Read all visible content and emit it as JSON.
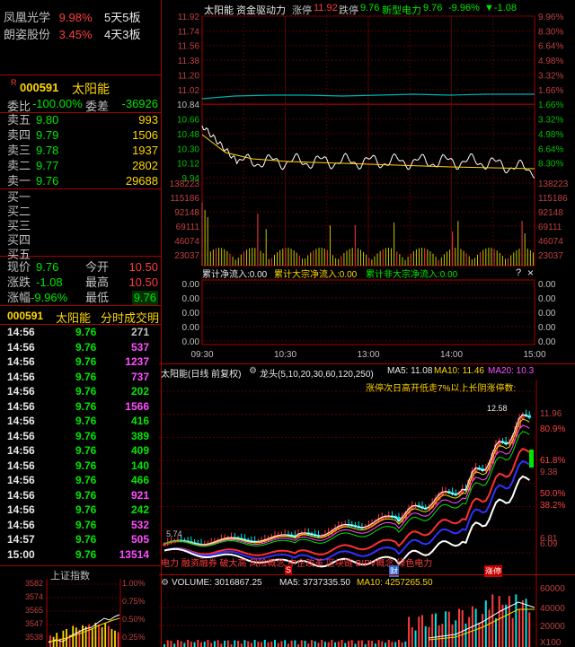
{
  "limit_up_board": [
    {
      "name": "凤凰光学",
      "pct": "9.98%",
      "streak": "5天5板"
    },
    {
      "name": "朗姿股份",
      "pct": "3.45%",
      "streak": "4天3板"
    }
  ],
  "stock": {
    "marker": "R",
    "code": "000591",
    "name": "太阳能"
  },
  "committee": {
    "ratio_label": "委比",
    "ratio": "-100.00%",
    "diff_label": "委差",
    "diff": "-36926"
  },
  "asks": [
    {
      "label": "卖五",
      "price": "9.80",
      "vol": "993"
    },
    {
      "label": "卖四",
      "price": "9.79",
      "vol": "1506"
    },
    {
      "label": "卖三",
      "price": "9.78",
      "vol": "1937"
    },
    {
      "label": "卖二",
      "price": "9.77",
      "vol": "2802"
    },
    {
      "label": "卖一",
      "price": "9.76",
      "vol": "29688"
    }
  ],
  "bids": [
    {
      "label": "买一"
    },
    {
      "label": "买二"
    },
    {
      "label": "买三"
    },
    {
      "label": "买四"
    },
    {
      "label": "买五"
    }
  ],
  "quote": {
    "price_label": "现价",
    "price": "9.76",
    "open_label": "今开",
    "open": "10.50",
    "change_label": "涨跌",
    "change": "-1.08",
    "high_label": "最高",
    "high": "10.50",
    "pct_label": "涨幅",
    "pct": "-9.96%",
    "low_label": "最低",
    "low": "9.76"
  },
  "ticks_header": {
    "code": "000591",
    "name": "太阳能",
    "title": "分时成交明"
  },
  "ticks": [
    {
      "time": "14:56",
      "price": "9.76",
      "vol": "271",
      "color": "grey"
    },
    {
      "time": "14:56",
      "price": "9.76",
      "vol": "537",
      "color": "magenta"
    },
    {
      "time": "14:56",
      "price": "9.76",
      "vol": "1237",
      "color": "magenta"
    },
    {
      "time": "14:56",
      "price": "9.76",
      "vol": "737",
      "color": "magenta"
    },
    {
      "time": "14:56",
      "price": "9.76",
      "vol": "202",
      "color": "green"
    },
    {
      "time": "14:56",
      "price": "9.76",
      "vol": "1566",
      "color": "magenta"
    },
    {
      "time": "14:56",
      "price": "9.76",
      "vol": "416",
      "color": "green"
    },
    {
      "time": "14:56",
      "price": "9.76",
      "vol": "389",
      "color": "green"
    },
    {
      "time": "14:56",
      "price": "9.76",
      "vol": "409",
      "color": "green"
    },
    {
      "time": "14:56",
      "price": "9.76",
      "vol": "140",
      "color": "green"
    },
    {
      "time": "14:56",
      "price": "9.76",
      "vol": "466",
      "color": "green"
    },
    {
      "time": "14:56",
      "price": "9.76",
      "vol": "921",
      "color": "magenta"
    },
    {
      "time": "14:56",
      "price": "9.76",
      "vol": "242",
      "color": "green"
    },
    {
      "time": "14:56",
      "price": "9.76",
      "vol": "532",
      "color": "magenta"
    },
    {
      "time": "14:57",
      "price": "9.76",
      "vol": "505",
      "color": "magenta"
    },
    {
      "time": "15:00",
      "price": "9.76",
      "vol": "13514",
      "color": "magenta"
    }
  ],
  "mini_index": {
    "title": "上证指数",
    "left_axis": [
      "3582",
      "3574",
      "3565",
      "3547",
      "3538"
    ],
    "right_axis": [
      "1.00%",
      "0.75%",
      "0.50%",
      "0.25%"
    ]
  },
  "intraday": {
    "header": {
      "name": "太阳能",
      "tag": "资金驱动力",
      "limit_up_label": "涨停",
      "limit_up": "11.92",
      "limit_down_label": "跌停",
      "limit_down": "9.76",
      "sector": "新型电力",
      "sector_price": "9.76",
      "sector_pct": "-9.96%",
      "sector_chg": "▼-1.08"
    },
    "price_axis": [
      "11.92",
      "11.74",
      "11.56",
      "11.38",
      "11.20",
      "11.02",
      "10.84",
      "10.66",
      "10.48",
      "10.30",
      "10.12",
      "9.94"
    ],
    "pct_axis": [
      "9.96%",
      "8.30%",
      "6.64%",
      "4.98%",
      "3.32%",
      "1.66%",
      "1.66%",
      "3.32%",
      "4.98%",
      "6.64%",
      "8.30%"
    ],
    "vol_axis": [
      "138223",
      "115186",
      "92148",
      "69111",
      "46074",
      "23037"
    ],
    "flow_labels": {
      "a": "累计净流入:0.00",
      "b": "累计大宗净流入:0.00",
      "c": "累计非大宗净流入:0.00",
      "help": "?",
      "close": "×"
    },
    "flow_axis": [
      "0.00",
      "0.00",
      "0.00",
      "0.00",
      "0.00"
    ],
    "time_axis": [
      "09:30",
      "10:30",
      "13:00",
      "14:00",
      "15:00"
    ]
  },
  "kline": {
    "title": "太阳能(日线 前复权)",
    "indicator": "龙头(5,10,20,30,60,120,250)",
    "ma5": "MA5: 11.08",
    "ma10": "MA10: 11.46",
    "ma20": "MA20: 10.3",
    "annotation": "涨停次日高开低走7%以上长阴涨停数:",
    "high_label": "12.58",
    "low_label": "5.74",
    "price_axis": [
      "11.96",
      "80.9%",
      "61.8%",
      "9.38",
      "50.0%",
      "38.2%",
      "6.81",
      "6.09"
    ],
    "concepts": "电力 融资融券 破大高 风险概念 中企改革 区块链 BIPV概念 绿色电力",
    "markers": {
      "s": "S",
      "cai": "财",
      "zhangting": "涨停"
    }
  },
  "volume": {
    "label": "VOLUME: 3016867.25",
    "ma5": "MA5: 3737335.50",
    "ma10": "MA10: 4257265.50",
    "axis": [
      "60000",
      "40000",
      "20000",
      "X100"
    ]
  },
  "colors": {
    "up": "#ff3c3c",
    "down": "#00e600",
    "grid": "#a00000",
    "bg": "#000000"
  }
}
